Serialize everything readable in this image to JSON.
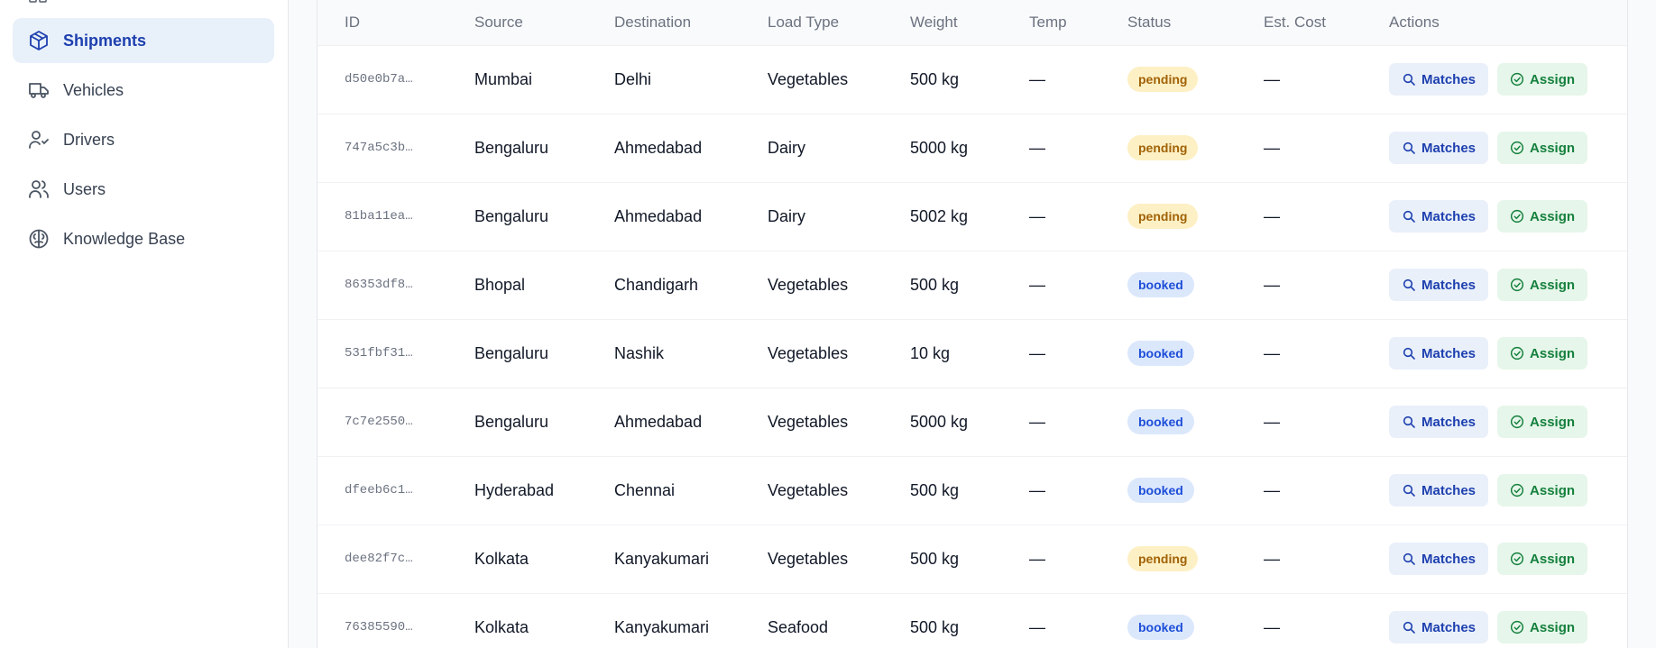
{
  "sidebar": {
    "items": [
      {
        "label": "Shipments",
        "icon": "package-icon",
        "active": true
      },
      {
        "label": "Vehicles",
        "icon": "truck-icon",
        "active": false
      },
      {
        "label": "Drivers",
        "icon": "user-check-icon",
        "active": false
      },
      {
        "label": "Users",
        "icon": "users-icon",
        "active": false
      },
      {
        "label": "Knowledge Base",
        "icon": "brain-icon",
        "active": false
      }
    ]
  },
  "table": {
    "headers": {
      "id": "ID",
      "source": "Source",
      "destination": "Destination",
      "load_type": "Load Type",
      "weight": "Weight",
      "temp": "Temp",
      "status": "Status",
      "est_cost": "Est. Cost",
      "actions": "Actions"
    },
    "matches_label": "Matches",
    "assign_label": "Assign",
    "rows": [
      {
        "id": "d50e0b7a…",
        "source": "Mumbai",
        "destination": "Delhi",
        "load_type": "Vegetables",
        "weight": "500 kg",
        "temp": "—",
        "status": "pending",
        "est_cost": "—"
      },
      {
        "id": "747a5c3b…",
        "source": "Bengaluru",
        "destination": "Ahmedabad",
        "load_type": "Dairy",
        "weight": "5000 kg",
        "temp": "—",
        "status": "pending",
        "est_cost": "—"
      },
      {
        "id": "81ba11ea…",
        "source": "Bengaluru",
        "destination": "Ahmedabad",
        "load_type": "Dairy",
        "weight": "5002 kg",
        "temp": "—",
        "status": "pending",
        "est_cost": "—"
      },
      {
        "id": "86353df8…",
        "source": "Bhopal",
        "destination": "Chandigarh",
        "load_type": "Vegetables",
        "weight": "500 kg",
        "temp": "—",
        "status": "booked",
        "est_cost": "—"
      },
      {
        "id": "531fbf31…",
        "source": "Bengaluru",
        "destination": "Nashik",
        "load_type": "Vegetables",
        "weight": "10 kg",
        "temp": "—",
        "status": "booked",
        "est_cost": "—"
      },
      {
        "id": "7c7e2550…",
        "source": "Bengaluru",
        "destination": "Ahmedabad",
        "load_type": "Vegetables",
        "weight": "5000 kg",
        "temp": "—",
        "status": "booked",
        "est_cost": "—"
      },
      {
        "id": "dfeeb6c1…",
        "source": "Hyderabad",
        "destination": "Chennai",
        "load_type": "Vegetables",
        "weight": "500 kg",
        "temp": "—",
        "status": "booked",
        "est_cost": "—"
      },
      {
        "id": "dee82f7c…",
        "source": "Kolkata",
        "destination": "Kanyakumari",
        "load_type": "Vegetables",
        "weight": "500 kg",
        "temp": "—",
        "status": "pending",
        "est_cost": "—"
      },
      {
        "id": "76385590…",
        "source": "Kolkata",
        "destination": "Kanyakumari",
        "load_type": "Seafood",
        "weight": "500 kg",
        "temp": "—",
        "status": "booked",
        "est_cost": "—"
      }
    ]
  },
  "colors": {
    "accent": "#1e40af",
    "active_nav_bg": "#e8f0fa",
    "pending_bg": "#fdf0c4",
    "pending_text": "#a16207",
    "booked_bg": "#dbe7fb",
    "booked_text": "#1d4ed8",
    "assign_text": "#15803d"
  }
}
